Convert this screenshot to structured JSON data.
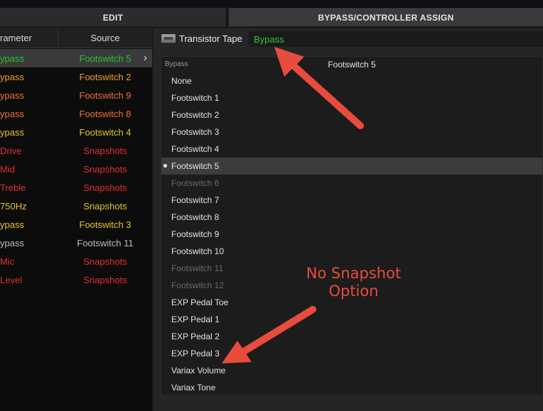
{
  "tabs": {
    "edit": "EDIT",
    "bypass_controller": "BYPASS/CONTROLLER ASSIGN"
  },
  "table": {
    "header_parameter": "rameter",
    "header_source": "Source",
    "rows": [
      {
        "param": "ypass",
        "source": "Footswitch 5",
        "color": "#22c52a",
        "selected": true
      },
      {
        "param": "ypass",
        "source": "Footswitch 2",
        "color": "#f0a030"
      },
      {
        "param": "ypass",
        "source": "Footswitch 9",
        "color": "#f07030"
      },
      {
        "param": "ypass",
        "source": "Footswitch 8",
        "color": "#f07030"
      },
      {
        "param": "ypass",
        "source": "Footswitch 4",
        "color": "#e3c42a"
      },
      {
        "param": "Drive",
        "source": "Snapshots",
        "color": "#e03030"
      },
      {
        "param": "Mid",
        "source": "Snapshots",
        "color": "#e03030"
      },
      {
        "param": "Treble",
        "source": "Snapshots",
        "color": "#e03030"
      },
      {
        "param": "750Hz",
        "source": "Snapshots",
        "color": "#e3c42a"
      },
      {
        "param": "ypass",
        "source": "Footswitch 3",
        "color": "#e3c42a"
      },
      {
        "param": "ypass",
        "source": "Footswitch 11",
        "color": "#bdbdbd"
      },
      {
        "param": "Mic",
        "source": "Snapshots",
        "color": "#e03030"
      },
      {
        "param": "Level",
        "source": "Snapshots",
        "color": "#e03030"
      }
    ]
  },
  "block": {
    "icon": "amp-block-icon",
    "name": "Transistor Tape",
    "parameter": "Bypass"
  },
  "dropdown": {
    "header_label": "Bypass",
    "header_value": "Footswitch 5",
    "items": [
      {
        "label": "None",
        "state": "enabled"
      },
      {
        "label": "Footswitch 1",
        "state": "enabled"
      },
      {
        "label": "Footswitch 2",
        "state": "enabled"
      },
      {
        "label": "Footswitch 3",
        "state": "enabled"
      },
      {
        "label": "Footswitch 4",
        "state": "enabled"
      },
      {
        "label": "Footswitch 5",
        "state": "selected"
      },
      {
        "label": "Footswitch 6",
        "state": "disabled"
      },
      {
        "label": "Footswitch 7",
        "state": "enabled"
      },
      {
        "label": "Footswitch 8",
        "state": "enabled"
      },
      {
        "label": "Footswitch 9",
        "state": "enabled"
      },
      {
        "label": "Footswitch 10",
        "state": "enabled"
      },
      {
        "label": "Footswitch 11",
        "state": "disabled"
      },
      {
        "label": "Footswitch 12",
        "state": "disabled"
      },
      {
        "label": "EXP Pedal Toe",
        "state": "enabled"
      },
      {
        "label": "EXP Pedal 1",
        "state": "enabled"
      },
      {
        "label": "EXP Pedal 2",
        "state": "enabled"
      },
      {
        "label": "EXP Pedal 3",
        "state": "enabled"
      },
      {
        "label": "Variax Volume",
        "state": "enabled"
      },
      {
        "label": "Variax Tone",
        "state": "enabled"
      }
    ]
  },
  "annotation": {
    "line1": "No Snapshot",
    "line2": "Option",
    "color": "#e74c3c"
  }
}
